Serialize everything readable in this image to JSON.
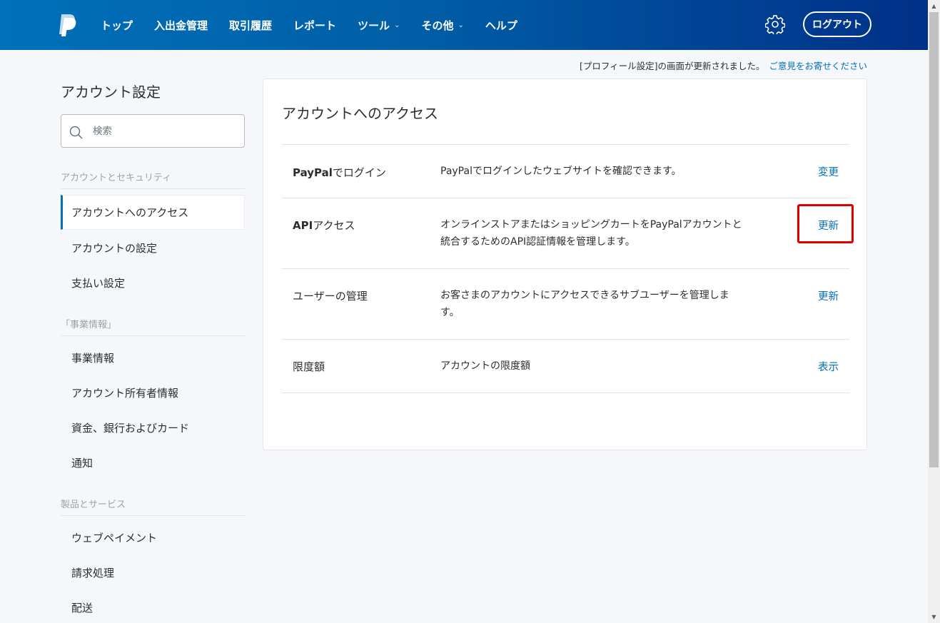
{
  "header": {
    "logo_icon": "paypal-logo",
    "nav": [
      {
        "label": "トップ",
        "dropdown": false
      },
      {
        "label": "入出金管理",
        "dropdown": false
      },
      {
        "label": "取引履歴",
        "dropdown": false
      },
      {
        "label": "レポート",
        "dropdown": false
      },
      {
        "label": "ツール",
        "dropdown": true
      },
      {
        "label": "その他",
        "dropdown": true
      },
      {
        "label": "ヘルプ",
        "dropdown": false
      }
    ],
    "settings_icon": "gear-icon",
    "logout_label": "ログアウト"
  },
  "notice": {
    "text": "[プロフィール設定]の画面が更新されました。",
    "link": "ご意見をお寄せください"
  },
  "sidebar": {
    "title": "アカウント設定",
    "search": {
      "placeholder": "検索",
      "value": "",
      "icon": "search-icon"
    },
    "sections": [
      {
        "label": "アカウントとセキュリティ",
        "items": [
          {
            "label": "アカウントへのアクセス",
            "active": true
          },
          {
            "label": "アカウントの設定",
            "active": false
          },
          {
            "label": "支払い設定",
            "active": false
          }
        ]
      },
      {
        "label": "「事業情報」",
        "items": [
          {
            "label": "事業情報",
            "active": false
          },
          {
            "label": "アカウント所有者情報",
            "active": false
          },
          {
            "label": "資金、銀行およびカード",
            "active": false
          },
          {
            "label": "通知",
            "active": false
          }
        ]
      },
      {
        "label": "製品とサービス",
        "items": [
          {
            "label": "ウェブペイメント",
            "active": false
          },
          {
            "label": "請求処理",
            "active": false
          },
          {
            "label": "配送",
            "active": false
          }
        ]
      }
    ]
  },
  "main": {
    "title": "アカウントへのアクセス",
    "rows": [
      {
        "name_bold": "PayPal",
        "name_rest": "でログイン",
        "desc": "PayPalでログインしたウェブサイトを確認できます。",
        "action": "変更"
      },
      {
        "name_bold": "API",
        "name_rest": "アクセス",
        "desc": "オンラインストアまたはショッピングカートをPayPalアカウントと統合するためのAPI認証情報を管理します。",
        "action": "更新"
      },
      {
        "name_bold": "",
        "name_rest": "ユーザーの管理",
        "desc": "お客さまのアカウントにアクセスできるサブユーザーを管理します。",
        "action": "更新"
      },
      {
        "name_bold": "",
        "name_rest": "限度額",
        "desc": "アカウントの限度額",
        "action": "表示"
      }
    ]
  },
  "colors": {
    "brand_blue": "#0070ba",
    "header_dark": "#003087",
    "highlight_red": "#e00000"
  }
}
